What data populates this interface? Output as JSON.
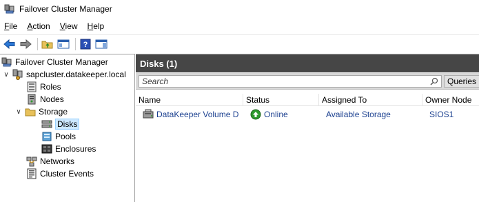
{
  "window": {
    "title": "Failover Cluster Manager"
  },
  "menu": {
    "file": {
      "first": "F",
      "rest": "ile"
    },
    "action": {
      "first": "A",
      "rest": "ction"
    },
    "view": {
      "first": "V",
      "rest": "iew"
    },
    "help": {
      "first": "H",
      "rest": "elp"
    }
  },
  "toolbar": [
    "back-icon",
    "forward-icon",
    "up-folder-icon",
    "show-hide-tree-icon",
    "help-icon",
    "action-pane-icon"
  ],
  "tree": {
    "root": "Failover Cluster Manager",
    "cluster": "sapcluster.datakeeper.local",
    "roles": "Roles",
    "nodes": "Nodes",
    "storage": "Storage",
    "disks": "Disks",
    "pools": "Pools",
    "enclosures": "Enclosures",
    "networks": "Networks",
    "cluster_events": "Cluster Events"
  },
  "panel": {
    "header": "Disks (1)",
    "search_placeholder": "Search",
    "queries_label": "Queries",
    "columns": {
      "name": "Name",
      "status": "Status",
      "assigned_to": "Assigned To",
      "owner_node": "Owner Node"
    },
    "rows": [
      {
        "name": "DataKeeper Volume D",
        "status": "Online",
        "assigned_to": "Available Storage",
        "owner_node": "SIOS1"
      }
    ]
  },
  "colors": {
    "header_bg": "#464646",
    "selection": "#cce8ff",
    "link_text": "#1a3f8f",
    "online_green": "#2e9a2e"
  }
}
